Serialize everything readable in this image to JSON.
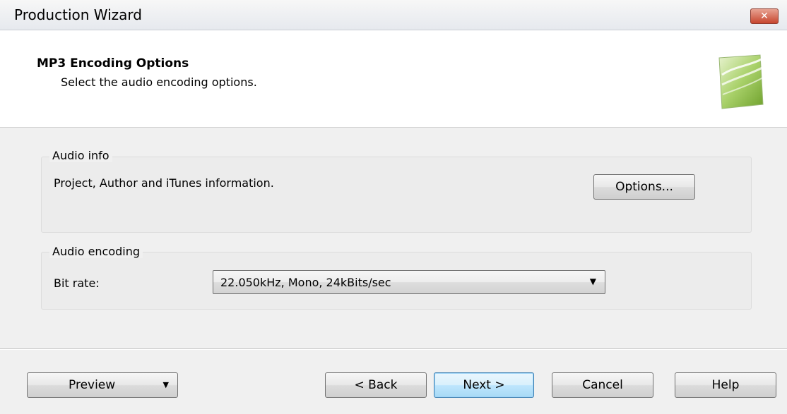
{
  "window": {
    "title": "Production Wizard",
    "close_glyph": "✕"
  },
  "header": {
    "title": "MP3 Encoding Options",
    "subtitle": "Select the audio encoding options."
  },
  "audio_info": {
    "group_label": "Audio info",
    "description": "Project, Author and iTunes information.",
    "options_button": "Options..."
  },
  "audio_encoding": {
    "group_label": "Audio encoding",
    "bit_rate_label": "Bit rate:",
    "bit_rate_value": "22.050kHz, Mono, 24kBits/sec"
  },
  "footer": {
    "preview_button": "Preview",
    "back_button": "< Back",
    "next_button": "Next >",
    "cancel_button": "Cancel",
    "help_button": "Help"
  },
  "colors": {
    "close_button": "#c7462f",
    "default_button_border": "#3c7fb1",
    "logo_green": "#8bbf3f"
  },
  "icons": {
    "close": "close-icon",
    "combo_arrow": "chevron-down-icon",
    "preview_arrow": "chevron-down-icon",
    "logo": "wizard-logo-icon"
  }
}
